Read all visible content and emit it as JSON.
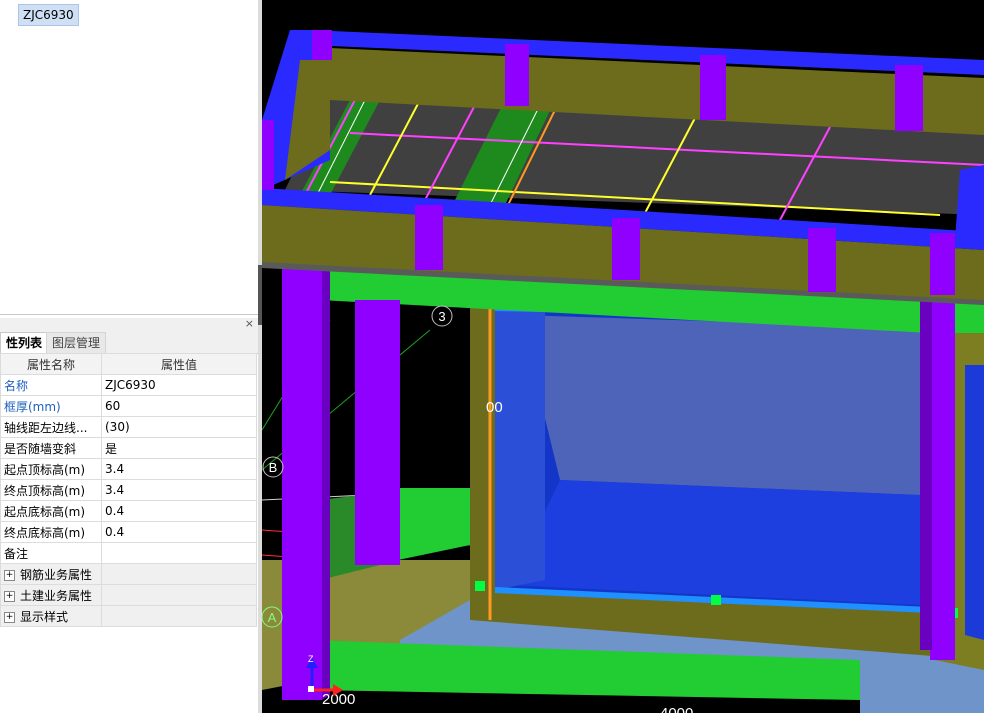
{
  "tree": {
    "selected_item": "ZJC6930"
  },
  "panel": {
    "close_label": "×",
    "tabs": [
      "性列表",
      "图层管理"
    ],
    "columns": [
      "属性名称",
      "属性值"
    ],
    "rows": [
      {
        "name": "名称",
        "value": "ZJC6930",
        "highlight": true
      },
      {
        "name": "框厚(mm)",
        "value": "60",
        "highlight": true
      },
      {
        "name": "轴线距左边线...",
        "value": "(30)",
        "highlight": false
      },
      {
        "name": "是否随墙变斜",
        "value": "是",
        "highlight": false
      },
      {
        "name": "起点顶标高(m)",
        "value": "3.4",
        "highlight": false
      },
      {
        "name": "终点顶标高(m)",
        "value": "3.4",
        "highlight": false
      },
      {
        "name": "起点底标高(m)",
        "value": "0.4",
        "highlight": false
      },
      {
        "name": "终点底标高(m)",
        "value": "0.4",
        "highlight": false
      },
      {
        "name": "备注",
        "value": "",
        "highlight": false
      }
    ],
    "groups": [
      "钢筋业务属性",
      "土建业务属性",
      "显示样式"
    ],
    "expand_symbol": "+"
  },
  "viewport": {
    "axis_labels": {
      "a3": "3",
      "aB": "B",
      "aA": "A",
      "aZ": "Z"
    },
    "dim_texts": {
      "d00": "00",
      "d2000": "2000",
      "d4000": "4000"
    },
    "colors": {
      "background": "#000000",
      "wall": "#7a7a1c",
      "column": "#8f00ff",
      "beam_blue": "#2a2aff",
      "slab": "#404040",
      "green": "#22cc33",
      "window_glass": "#4e64b8",
      "floor_blue": "#6f94c9"
    }
  }
}
